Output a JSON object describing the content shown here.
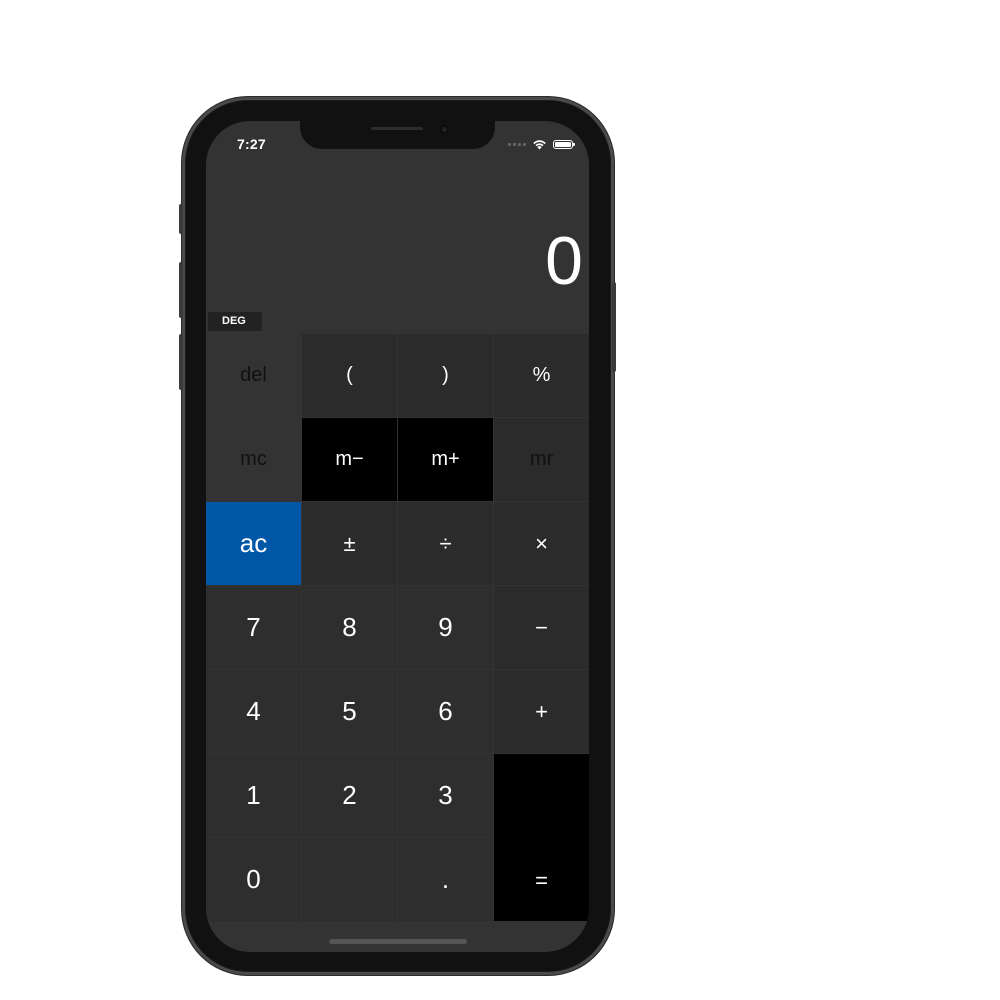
{
  "status": {
    "time": "7:27"
  },
  "display": {
    "value": "0",
    "mode": "DEG"
  },
  "keys": {
    "del": "del",
    "open_paren": "(",
    "close_paren": ")",
    "percent": "%",
    "mc": "mc",
    "m_minus": "m−",
    "m_plus": "m+",
    "mr": "mr",
    "ac": "ac",
    "plus_minus": "±",
    "divide": "÷",
    "multiply": "×",
    "seven": "7",
    "eight": "8",
    "nine": "9",
    "minus": "−",
    "four": "4",
    "five": "5",
    "six": "6",
    "plus": "+",
    "one": "1",
    "two": "2",
    "three": "3",
    "zero": "0",
    "decimal": ".",
    "equals": "="
  },
  "colors": {
    "screen_bg": "#333333",
    "key_bg": "#2e2e2e",
    "memory_key_bg": "#000000",
    "accent_ac": "#0057a8"
  },
  "icons": {
    "signal": "cellular-signal-icon",
    "wifi": "wifi-icon",
    "battery": "battery-icon"
  }
}
